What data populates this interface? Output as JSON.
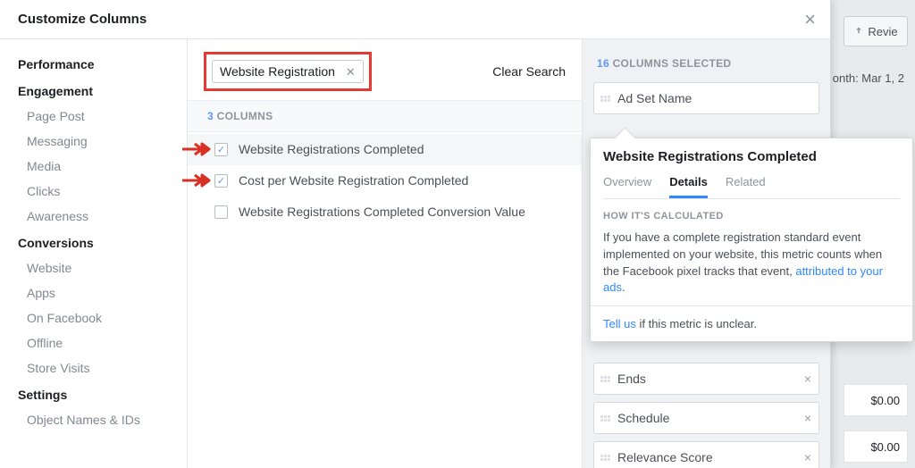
{
  "dialog": {
    "title": "Customize Columns"
  },
  "sidebar": {
    "groups": [
      {
        "heading": "Performance",
        "items": []
      },
      {
        "heading": "Engagement",
        "items": [
          "Page Post",
          "Messaging",
          "Media",
          "Clicks",
          "Awareness"
        ]
      },
      {
        "heading": "Conversions",
        "items": [
          "Website",
          "Apps",
          "On Facebook",
          "Offline",
          "Store Visits"
        ]
      },
      {
        "heading": "Settings",
        "items": [
          "Object Names & IDs"
        ]
      }
    ]
  },
  "search": {
    "term": "Website Registration",
    "clear_label": "Clear Search"
  },
  "columns": {
    "count": "3",
    "label": "COLUMNS",
    "items": [
      {
        "label": "Website Registrations Completed",
        "checked": true,
        "arrow": true,
        "highlight": true
      },
      {
        "label": "Cost per Website Registration Completed",
        "checked": true,
        "arrow": true
      },
      {
        "label": "Website Registrations Completed Conversion Value",
        "checked": false
      }
    ]
  },
  "selected": {
    "count": "16",
    "label": "COLUMNS SELECTED",
    "top_item": "Ad Set Name",
    "bottom_items": [
      {
        "label": "Ends",
        "removable": true
      },
      {
        "label": "Schedule",
        "removable": true
      },
      {
        "label": "Relevance Score",
        "removable": true
      }
    ]
  },
  "tooltip": {
    "title": "Website Registrations Completed",
    "tabs": [
      "Overview",
      "Details",
      "Related"
    ],
    "active_tab": 1,
    "subhead": "HOW IT'S CALCULATED",
    "body_prefix": "If you have a complete registration standard event implemented on your website, this metric counts when the Facebook pixel tracks that event, ",
    "body_link": "attributed to your ads",
    "body_suffix": ".",
    "footer_link": "Tell us",
    "footer_rest": " if this metric is unclear."
  },
  "background": {
    "review_btn": "Revie",
    "date_label": "onth: Mar 1, 2",
    "cost_value": "$0.00"
  }
}
